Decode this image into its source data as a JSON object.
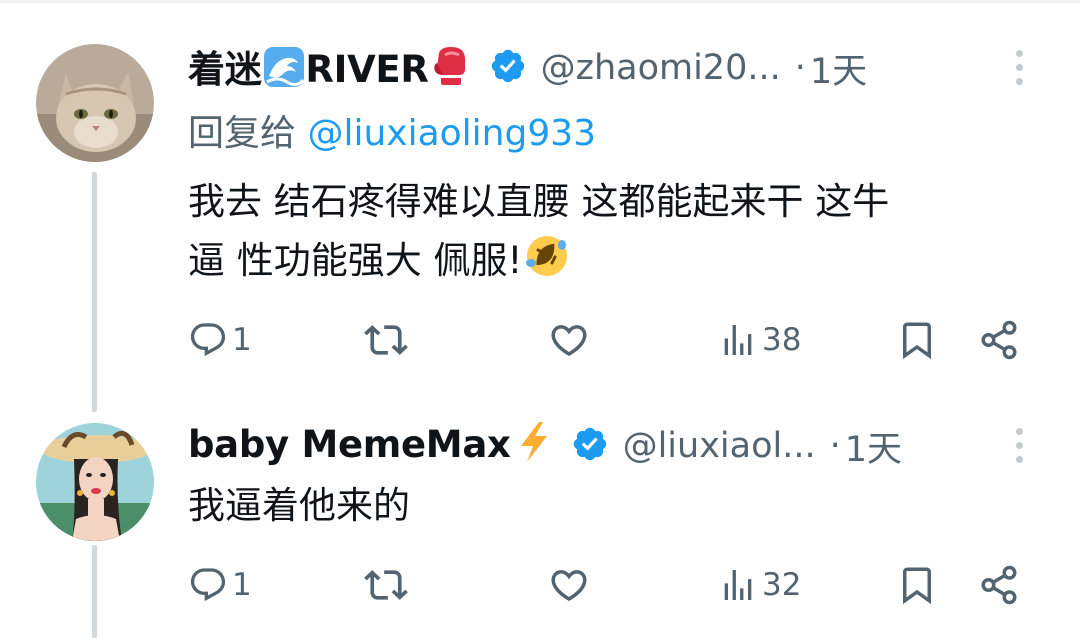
{
  "tweets": [
    {
      "display_name": "着迷",
      "display_name_suffix": "RIVER",
      "name_emojis": [
        "wave-emoji",
        "boxing-glove-emoji"
      ],
      "verified": true,
      "handle": "@zhaomi20...",
      "separator": "·",
      "time": "1天",
      "reply_prefix": "回复给",
      "reply_mention": "@liuxiaoling933",
      "text_line1": "我去 结石疼得难以直腰  这都能起来干 这牛",
      "text_line2": "逼  性功能强大 佩服!",
      "text_emoji": "rolling-on-floor-laughing-emoji",
      "counts": {
        "replies": "1",
        "retweets": "",
        "likes": "",
        "views": "38"
      }
    },
    {
      "display_name": "baby MemeMax",
      "name_emojis": [
        "lightning-emoji"
      ],
      "verified": true,
      "handle": "@liuxiaol...",
      "separator": "·",
      "time": "1天",
      "text_line1": "我逼着他来的",
      "counts": {
        "replies": "1",
        "retweets": "",
        "likes": "",
        "views": "32"
      }
    }
  ],
  "colors": {
    "verified": "#1d9bf0",
    "muted": "#536471",
    "mention": "#1d9bf0",
    "thread_line": "#cfd9de"
  }
}
